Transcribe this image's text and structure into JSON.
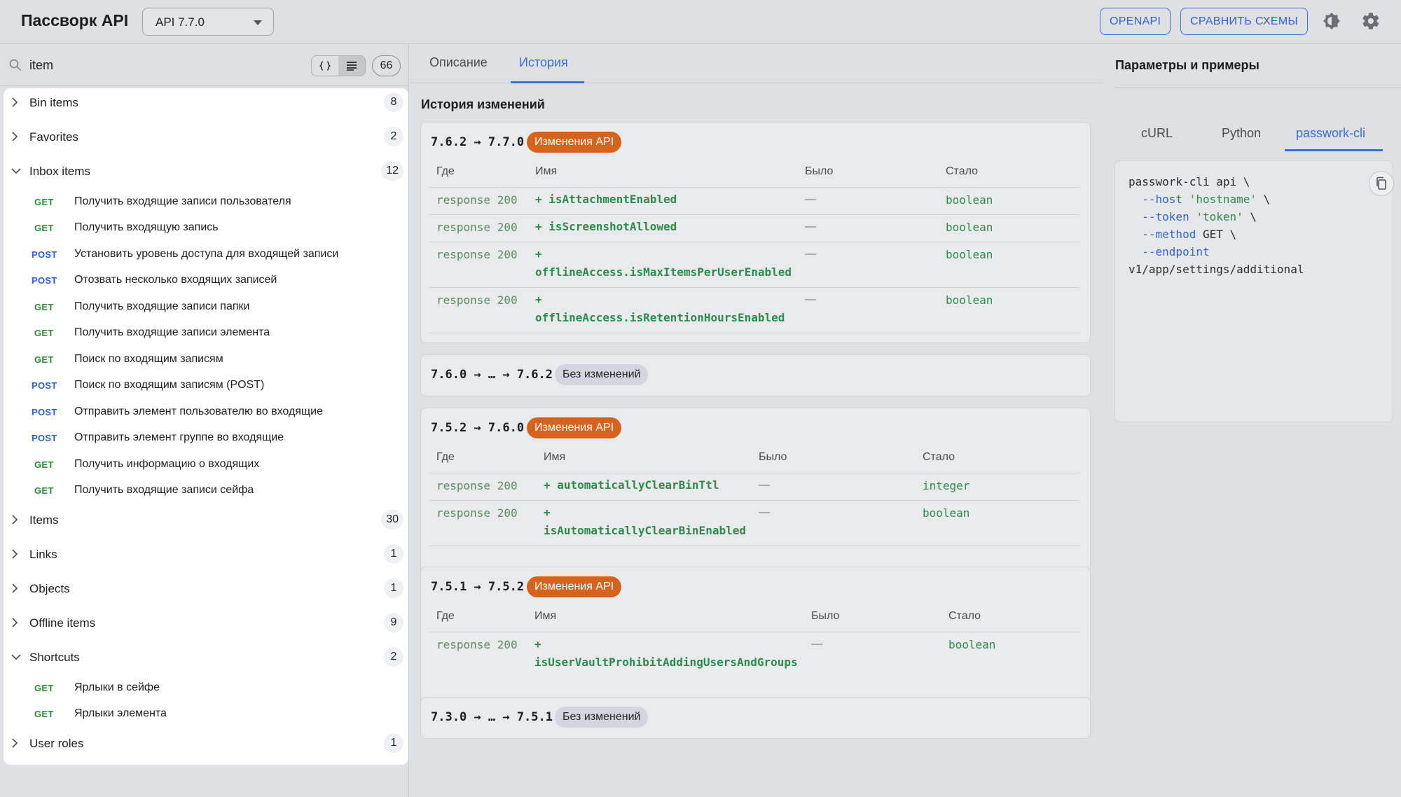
{
  "header": {
    "title": "Пассворк API",
    "version_selected": "API 7.7.0",
    "openapi_label": "OPENAPI",
    "compare_label": "СРАВНИТЬ СХЕМЫ",
    "theme_icon": "theme-toggle-icon",
    "settings_icon": "gear-icon"
  },
  "sidebar": {
    "search_value": "item",
    "total_count": "66",
    "toggle_icons": [
      "braces-icon",
      "list-icon"
    ],
    "groups": [
      {
        "name": "Bin items",
        "count": "8",
        "expanded": false
      },
      {
        "name": "Favorites",
        "count": "2",
        "expanded": false
      },
      {
        "name": "Inbox items",
        "count": "12",
        "expanded": true,
        "endpoints": [
          {
            "method": "GET",
            "name": "Получить входящие записи пользователя"
          },
          {
            "method": "GET",
            "name": "Получить входящую запись"
          },
          {
            "method": "POST",
            "name": "Установить уровень доступа для входящей записи"
          },
          {
            "method": "POST",
            "name": "Отозвать несколько входящих записей"
          },
          {
            "method": "GET",
            "name": "Получить входящие записи папки"
          },
          {
            "method": "GET",
            "name": "Получить входящие записи элемента"
          },
          {
            "method": "GET",
            "name": "Поиск по входящим записям"
          },
          {
            "method": "POST",
            "name": "Поиск по входящим записям (POST)"
          },
          {
            "method": "POST",
            "name": "Отправить элемент пользователю во входящие"
          },
          {
            "method": "POST",
            "name": "Отправить элемент группе во входящие"
          },
          {
            "method": "GET",
            "name": "Получить информацию о входящих"
          },
          {
            "method": "GET",
            "name": "Получить входящие записи сейфа"
          }
        ]
      },
      {
        "name": "Items",
        "count": "30",
        "expanded": false
      },
      {
        "name": "Links",
        "count": "1",
        "expanded": false
      },
      {
        "name": "Objects",
        "count": "1",
        "expanded": false
      },
      {
        "name": "Offline items",
        "count": "9",
        "expanded": false
      },
      {
        "name": "Shortcuts",
        "count": "2",
        "expanded": true,
        "endpoints": [
          {
            "method": "GET",
            "name": "Ярлыки в сейфе"
          },
          {
            "method": "GET",
            "name": "Ярлыки элемента"
          }
        ]
      },
      {
        "name": "User roles",
        "count": "1",
        "expanded": false
      }
    ]
  },
  "center": {
    "tabs": [
      "Описание",
      "История"
    ],
    "active_tab": "История",
    "section_title": "История изменений",
    "changes": [
      {
        "version": "7.6.2 → 7.7.0",
        "badge": "Изменения API",
        "headers": [
          "Где",
          "Имя",
          "Было",
          "Стало"
        ],
        "rows": [
          {
            "where": "response 200",
            "name_lines": [
              "+ isAttachmentEnabled"
            ],
            "was": "—",
            "now": "boolean"
          },
          {
            "where": "response 200",
            "name_lines": [
              "+ isScreenshotAllowed"
            ],
            "was": "—",
            "now": "boolean"
          },
          {
            "where": "response 200",
            "name_lines": [
              "+",
              "offlineAccess.isMaxItemsPerUserEnabled"
            ],
            "was": "—",
            "now": "boolean"
          },
          {
            "where": "response 200",
            "name_lines": [
              "+",
              "offlineAccess.isRetentionHoursEnabled"
            ],
            "was": "—",
            "now": "boolean"
          }
        ]
      },
      {
        "version": "7.6.0 → … → 7.6.2",
        "badge": "Без изменений"
      },
      {
        "version": "7.5.2 → 7.6.0",
        "badge": "Изменения API",
        "headers": [
          "Где",
          "Имя",
          "Было",
          "Стало"
        ],
        "rows": [
          {
            "where": "response 200",
            "name_lines": [
              "+ automaticallyClearBinTtl"
            ],
            "was": "—",
            "now": "integer"
          },
          {
            "where": "response 200",
            "name_lines": [
              "+",
              "isAutomaticallyClearBinEnabled"
            ],
            "was": "—",
            "now": "boolean"
          }
        ]
      },
      {
        "version": "7.5.1 → 7.5.2",
        "badge": "Изменения API",
        "headers": [
          "Где",
          "Имя",
          "Было",
          "Стало"
        ],
        "rows": [
          {
            "where": "response 200",
            "name_lines": [
              "+",
              "isUserVaultProhibitAddingUsersAndGroups"
            ],
            "was": "—",
            "now": "boolean"
          }
        ]
      },
      {
        "version": "7.3.0 → … → 7.5.1",
        "badge": "Без изменений"
      }
    ]
  },
  "right": {
    "title": "Параметры и примеры",
    "tabs": [
      "cURL",
      "Python",
      "passwork-cli"
    ],
    "active_tab": "passwork-cli",
    "code": {
      "line1": "passwork-cli api \\",
      "host_flag": "--host",
      "host_val": "'hostname'",
      "token_flag": "--token",
      "token_val": "'token'",
      "method_flag": "--method",
      "method_val": "GET",
      "endpoint_flag": "--endpoint",
      "endpoint_val": "v1/app/settings/additional",
      "cont": "\\"
    },
    "copy_icon": "copy-icon"
  },
  "colors": {
    "accent": "#3a6fd8",
    "badge_changes": "#d6631d",
    "get_method": "#2f8a3a",
    "post_method": "#2a62c9",
    "added_field": "#2e8a4c"
  }
}
